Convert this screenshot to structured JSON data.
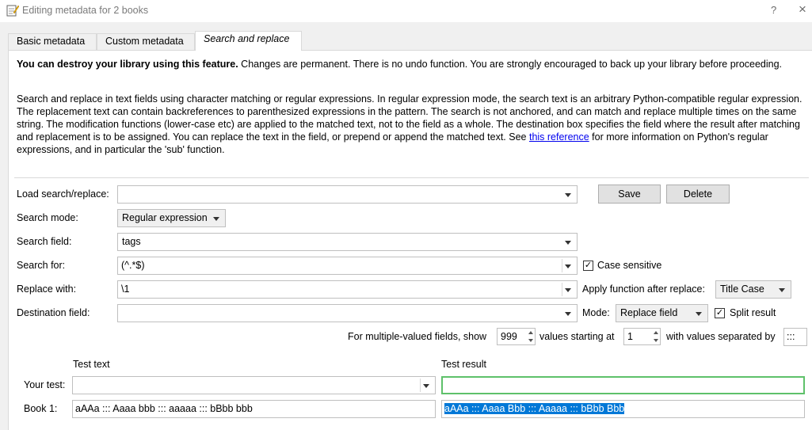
{
  "window": {
    "title": "Editing metadata for 2 books",
    "help": "?",
    "close": "×"
  },
  "tabs": [
    {
      "label": "Basic metadata"
    },
    {
      "label": "Custom metadata"
    },
    {
      "label": "Search and replace",
      "active": true
    }
  ],
  "warning": {
    "bold": "You can destroy your library using this feature.",
    "rest": " Changes are permanent. There is no undo function. You are strongly encouraged to back up your library before proceeding."
  },
  "description": {
    "before_link": "Search and replace in text fields using character matching or regular expressions. In regular expression mode, the search text is an arbitrary Python-compatible regular expression. The replacement text can contain backreferences to parenthesized expressions in the pattern. The search is not anchored, and can match and replace multiple times on the same string. The modification functions (lower-case etc) are applied to the matched text, not to the field as a whole. The destination box specifies the field where the result after matching and replacement is to be assigned. You can replace the text in the field, or prepend or append the matched text. See ",
    "link": "this reference",
    "after_link": " for more information on Python's regular expressions, and in particular the 'sub' function."
  },
  "form": {
    "load_label": "Load search/replace:",
    "load_value": "",
    "save_button": "Save",
    "delete_button": "Delete",
    "mode_label": "Search mode:",
    "mode_value": "Regular expression",
    "field_label": "Search field:",
    "field_value": "tags",
    "search_for_label": "Search for:",
    "search_for_value": "(^.*$)",
    "case_sensitive_label": "Case sensitive",
    "case_sensitive_checked": true,
    "replace_label": "Replace with:",
    "replace_value": "\\1",
    "apply_fn_label": "Apply function after replace:",
    "apply_fn_value": "Title Case",
    "dest_label": "Destination field:",
    "dest_value": "",
    "dest_mode_label": "Mode:",
    "dest_mode_value": "Replace field",
    "split_result_label": "Split result",
    "split_result_checked": true,
    "multi_show_label": "For multiple-valued fields, show",
    "multi_show_value": "999",
    "multi_start_label": "values starting at",
    "multi_start_value": "1",
    "multi_sep_label": "with values separated by",
    "multi_sep_value": ":::"
  },
  "test": {
    "test_text_header": "Test text",
    "test_result_header": "Test result",
    "your_test_label": "Your test:",
    "your_test_value": "",
    "your_test_result": "",
    "book1_label": "Book 1:",
    "book1_text": "aAAa ::: Aaaa bbb ::: aaaaa ::: bBbb bbb",
    "book1_result": "aAAa ::: Aaaa Bbb ::: Aaaaa ::: bBbb Bbb"
  },
  "colors": {
    "accent": "#0078d7",
    "link": "#0000ee",
    "focus_border": "#5ec16a"
  }
}
